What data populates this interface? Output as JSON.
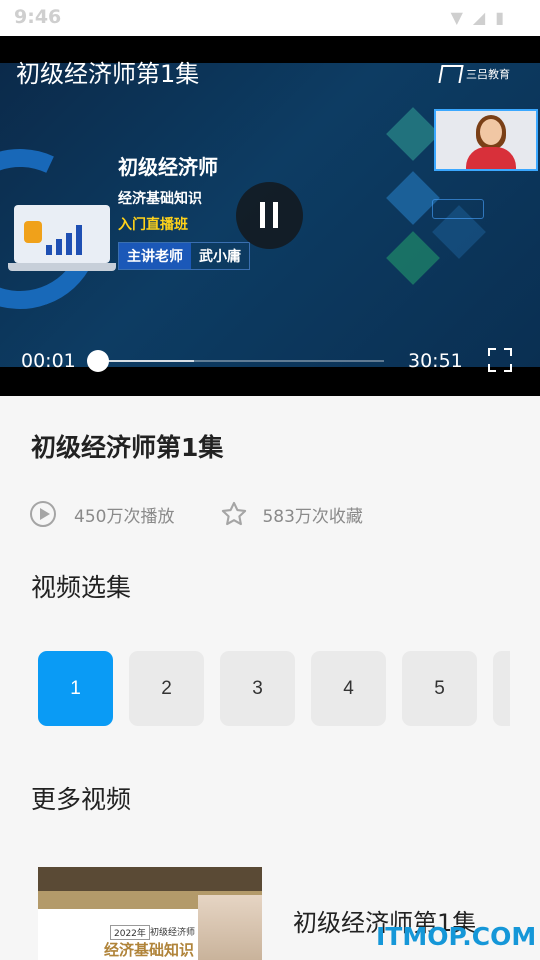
{
  "status_bar": {
    "time": "9:46"
  },
  "player": {
    "title": "初级经济师第1集",
    "current_time": "00:01",
    "duration": "30:51",
    "progress": 0.0,
    "buffered": 0.34,
    "logo_text": "三吕教育",
    "slide": {
      "heading": "初级经济师",
      "subject": "经济基础知识",
      "class_type": "入门直播班",
      "teacher_label": "主讲老师",
      "teacher_name": "武小庸"
    }
  },
  "video_info": {
    "title": "初级经济师第1集",
    "plays": "450万次播放",
    "favorites": "583万次收藏"
  },
  "episodes": {
    "section_title": "视频选集",
    "items": [
      "1",
      "2",
      "3",
      "4",
      "5"
    ],
    "selected": "1"
  },
  "more_videos": {
    "section_title": "更多视频",
    "items": [
      {
        "title": "初级经济师第1集",
        "thumb_year": "2022年",
        "thumb_label": "初级经济师",
        "thumb_subject": "经济基础知识"
      }
    ]
  },
  "watermark": "ITMOP.COM",
  "colors": {
    "accent": "#0a9bf5",
    "player_bg": "#0d3c63",
    "highlight_yellow": "#ffd21a"
  },
  "icons": [
    "wifi-icon",
    "signal-icon",
    "battery-icon",
    "pause-icon",
    "fullscreen-icon",
    "play-circle-icon",
    "star-icon"
  ]
}
